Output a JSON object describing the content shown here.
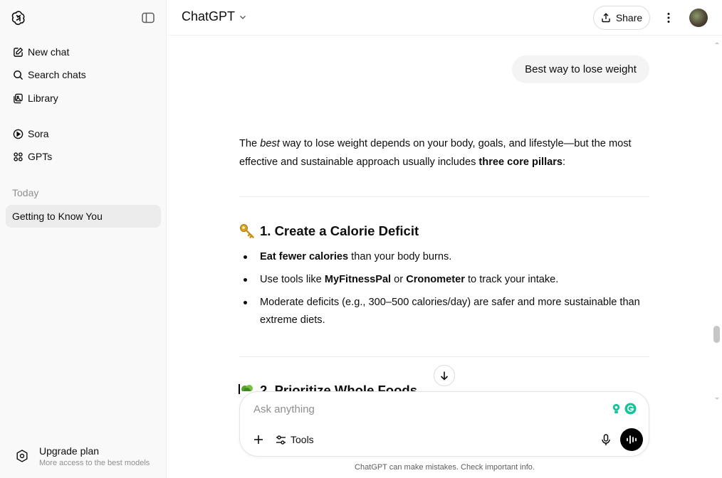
{
  "sidebar": {
    "nav": [
      {
        "label": "New chat",
        "icon": "edit-icon"
      },
      {
        "label": "Search chats",
        "icon": "search-icon"
      },
      {
        "label": "Library",
        "icon": "library-icon"
      },
      {
        "label": "Sora",
        "icon": "play-circle-icon"
      },
      {
        "label": "GPTs",
        "icon": "grid-icon"
      }
    ],
    "section_label": "Today",
    "chats": [
      {
        "label": "Getting to Know You"
      }
    ],
    "upgrade": {
      "title": "Upgrade plan",
      "subtitle": "More access to the best models"
    }
  },
  "header": {
    "model": "ChatGPT",
    "share_label": "Share"
  },
  "conversation": {
    "user_message": "Best way to lose weight",
    "intro": {
      "pre": "The ",
      "em": "best",
      "mid": " way to lose weight depends on your body, goals, and lifestyle—but the most effective and sustainable approach usually includes ",
      "strong": "three core pillars",
      "post": ":"
    },
    "section1": {
      "title": "1. Create a Calorie Deficit",
      "bullets": [
        {
          "strong": "Eat fewer calories",
          "text": " than your body burns."
        },
        {
          "pre": "Use tools like ",
          "strong1": "MyFitnessPal",
          "mid": " or ",
          "strong2": "Cronometer",
          "post": " to track your intake."
        },
        {
          "text": "Moderate deficits (e.g., 300–500 calories/day) are safer and more sustainable than extreme diets."
        }
      ]
    },
    "section2": {
      "title": "2. Prioritize Whole Foods"
    }
  },
  "composer": {
    "placeholder": "Ask anything",
    "tools_label": "Tools"
  },
  "disclaimer": "ChatGPT can make mistakes. Check important info.",
  "colors": {
    "sidebar_bg": "#f9f9f9",
    "selected_chat_bg": "#ececec",
    "user_bubble_bg": "#f4f4f4",
    "voice_button_bg": "#000000",
    "grammarly_green": "#15c39a"
  }
}
